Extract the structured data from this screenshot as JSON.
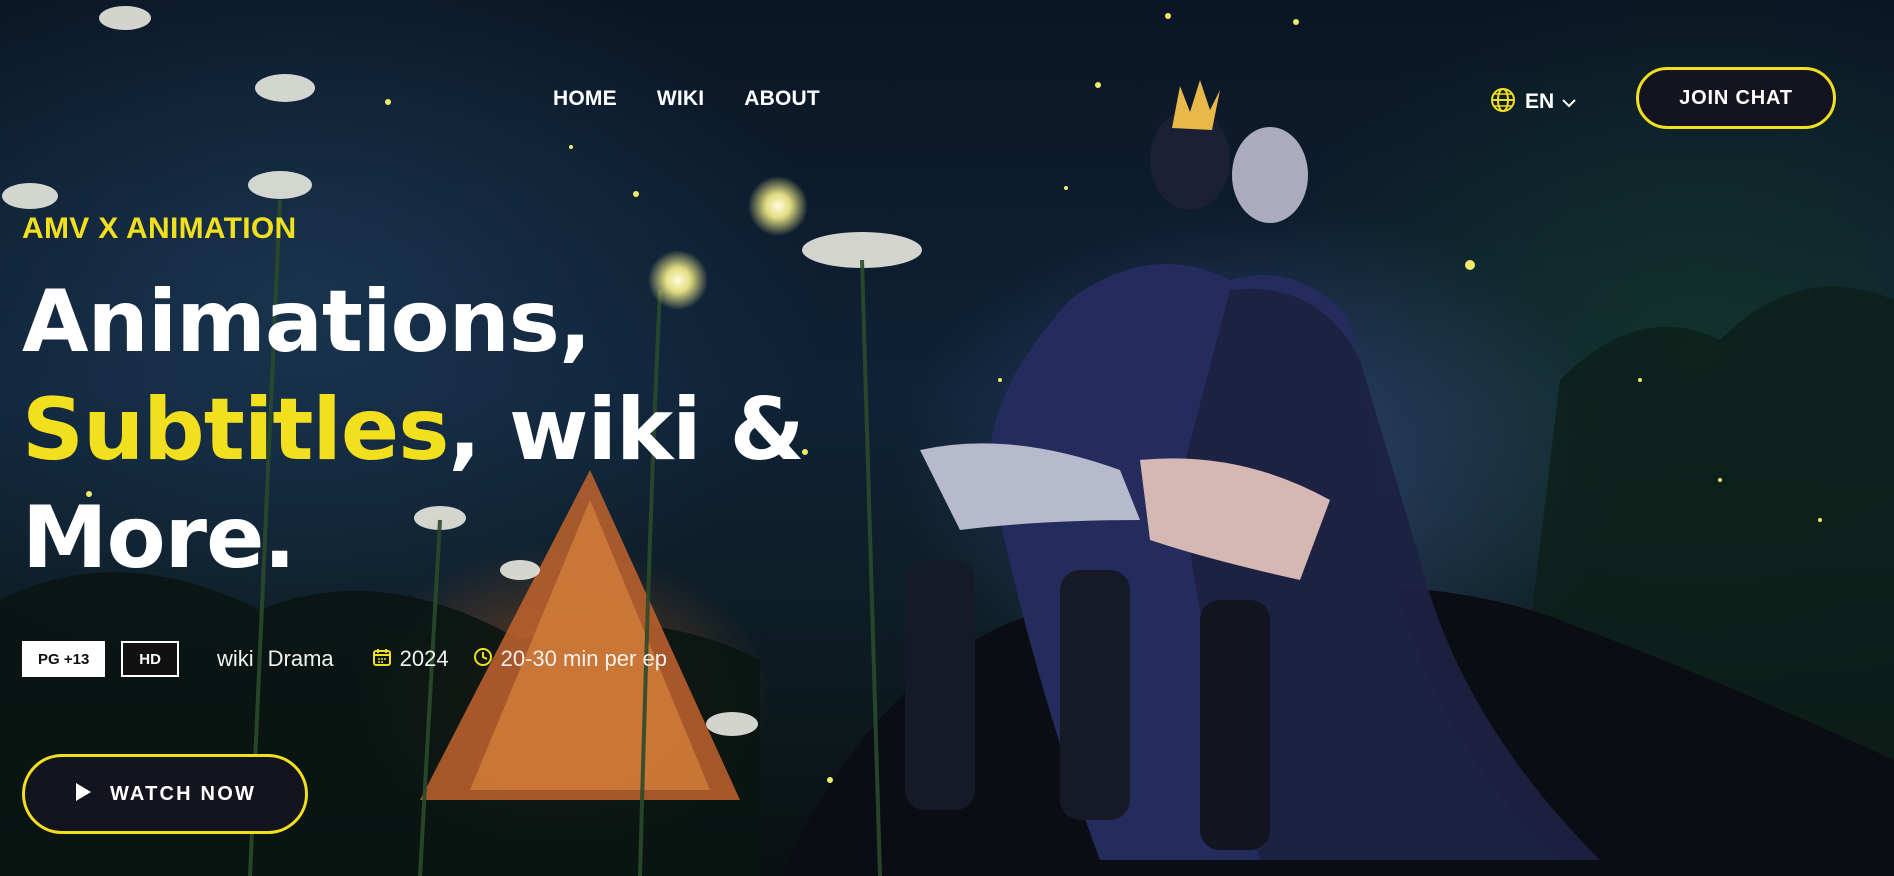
{
  "nav": {
    "links": [
      "HOME",
      "WIKI",
      "ABOUT"
    ],
    "language": "EN",
    "join_label": "JOIN CHAT"
  },
  "hero": {
    "eyebrow": "AMV X ANIMATION",
    "headline_line1": "Animations,",
    "headline_highlight": "Subtitles",
    "headline_line2_rest": ", wiki &",
    "headline_line3": "More.",
    "badges": [
      "PG +13",
      "HD"
    ],
    "genres": [
      "wiki",
      "Drama"
    ],
    "year": "2024",
    "duration": "20-30 min per ep",
    "cta_label": "WATCH NOW"
  },
  "colors": {
    "accent": "#f2df1d",
    "text": "#ffffff",
    "button_bg": "#141420"
  },
  "icons": [
    "globe-icon",
    "chevron-down-icon",
    "calendar-icon",
    "clock-icon",
    "play-icon"
  ]
}
